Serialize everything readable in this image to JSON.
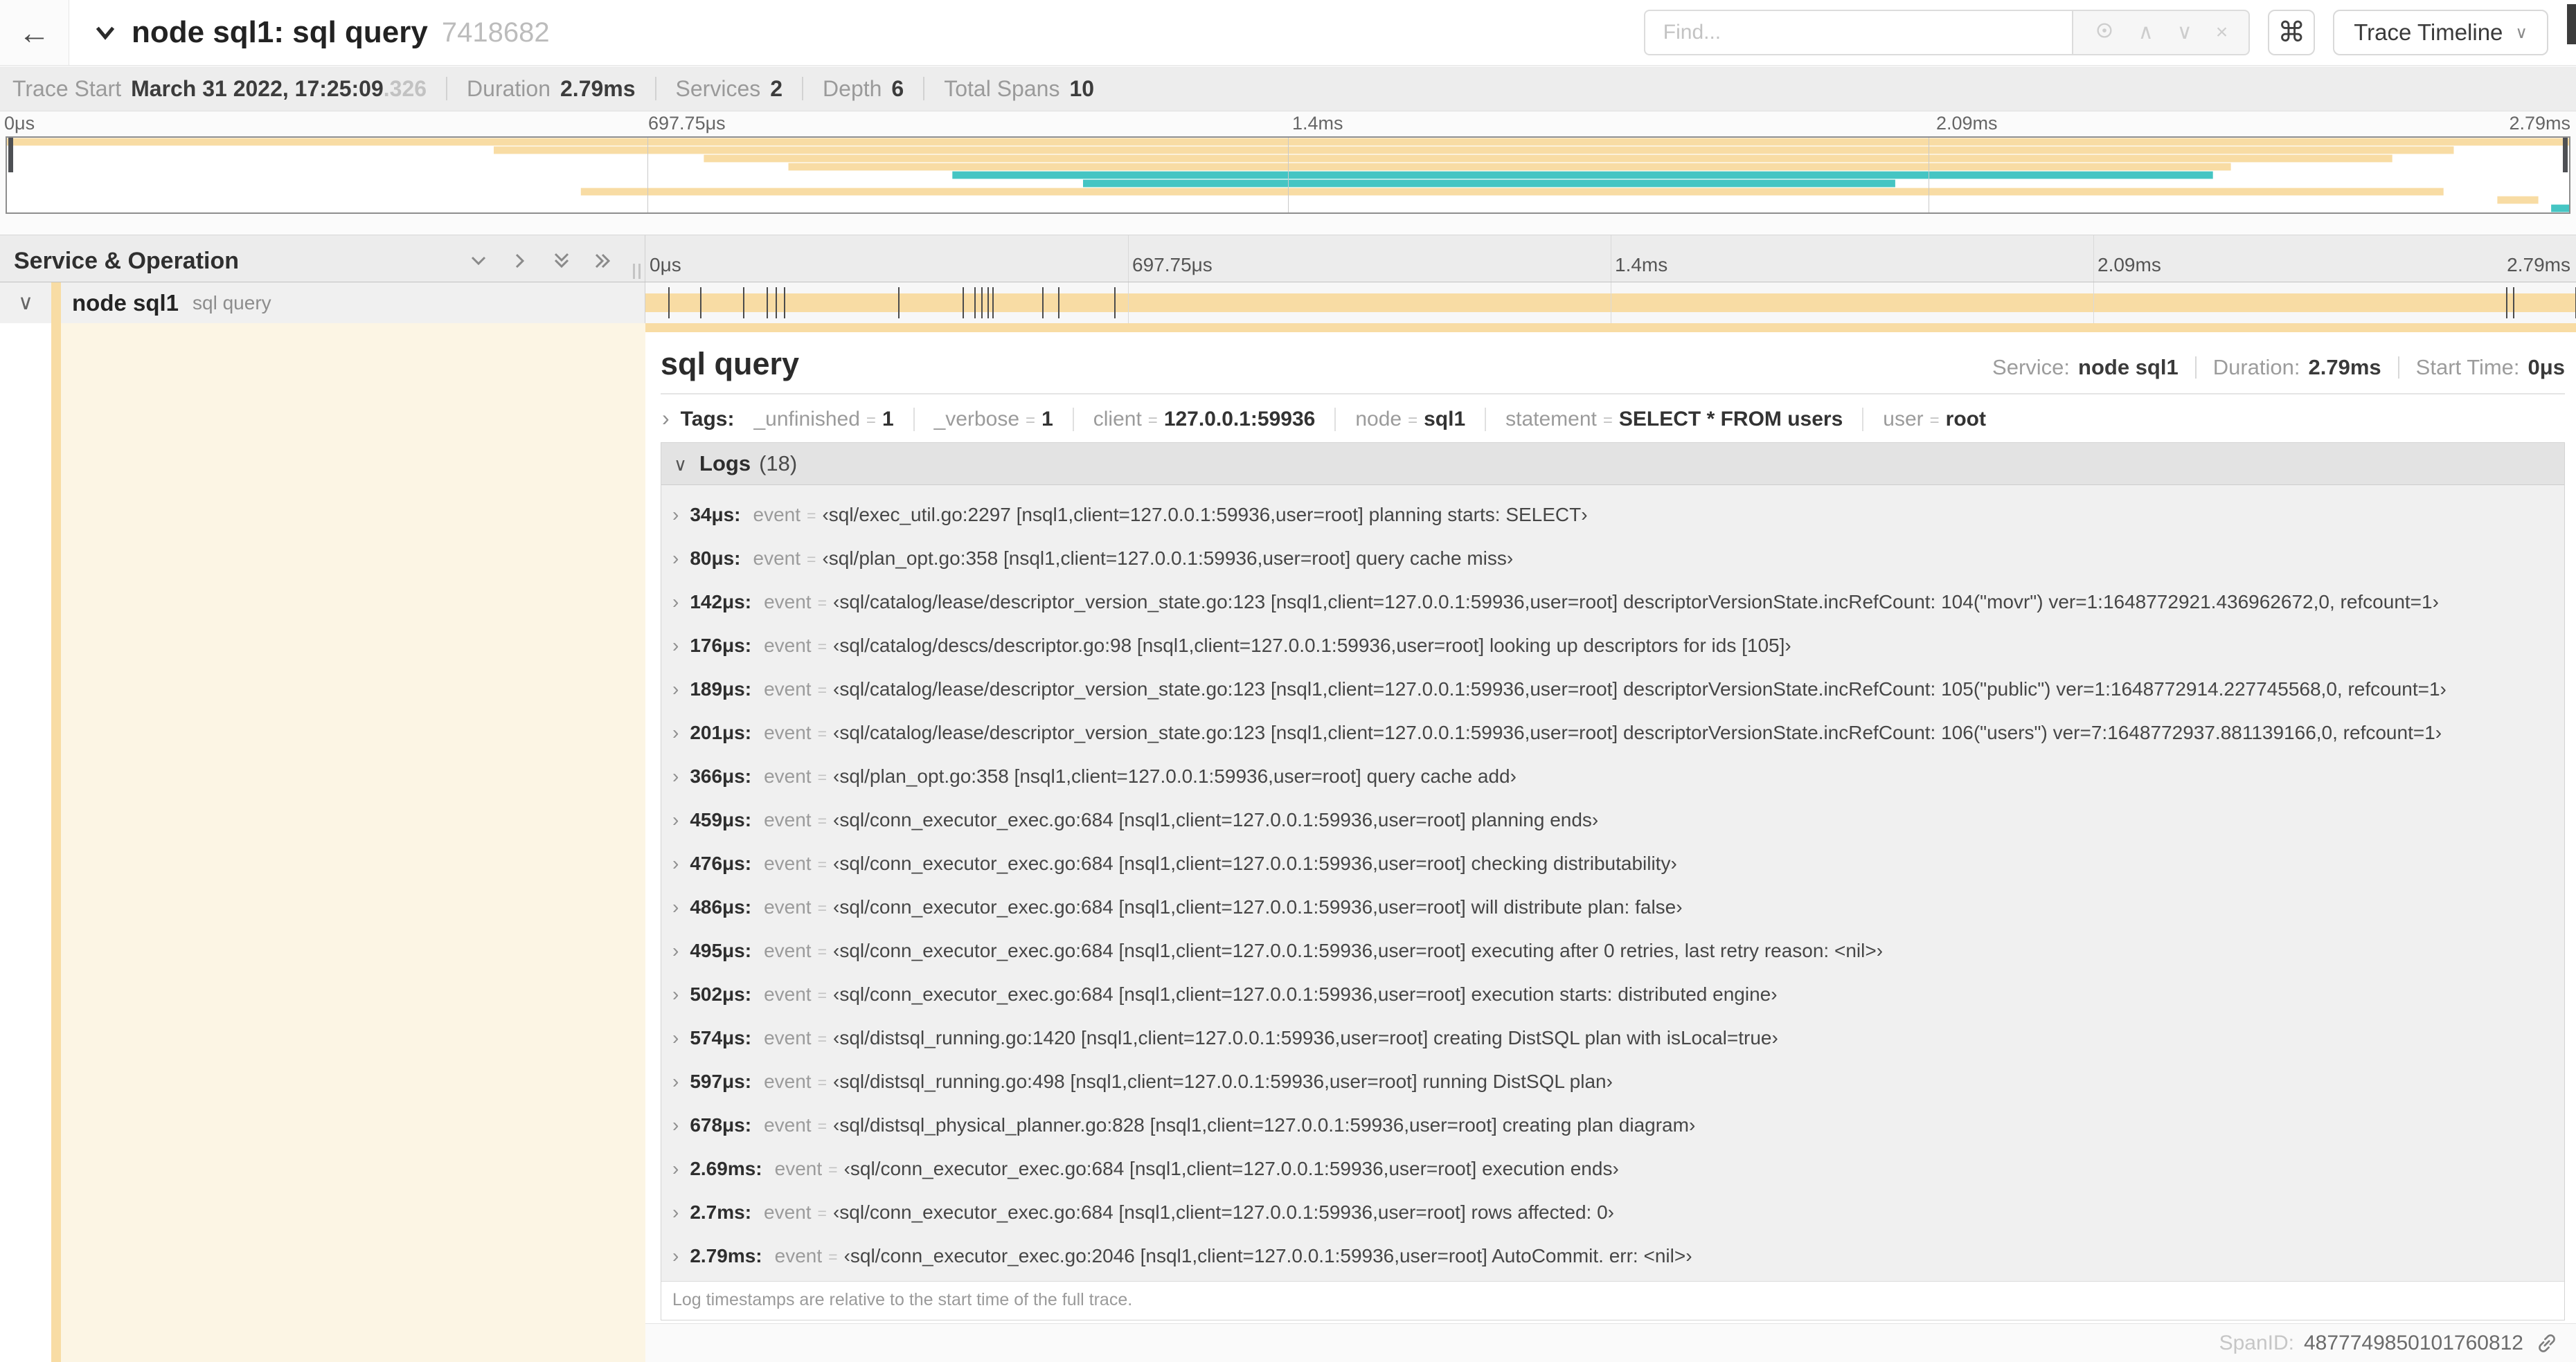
{
  "topbar": {
    "back_label": "←",
    "title": "node sql1: sql query",
    "trace_id": "7418682",
    "find_placeholder": "Find...",
    "find_up": "∧",
    "find_down": "∨",
    "find_close": "×",
    "cmd_label": "⌘",
    "view_label": "Trace Timeline",
    "view_caret": "∨"
  },
  "trace_info": {
    "items": [
      {
        "label": "Trace Start",
        "value": "March 31 2022, 17:25:09",
        "suffix": ".326"
      },
      {
        "label": "Duration",
        "value": "2.79ms"
      },
      {
        "label": "Services",
        "value": "2"
      },
      {
        "label": "Depth",
        "value": "6"
      },
      {
        "label": "Total Spans",
        "value": "10"
      }
    ]
  },
  "timeline": {
    "tick_labels": [
      "0μs",
      "697.75μs",
      "1.4ms",
      "2.09ms",
      "2.79ms"
    ],
    "duration_us": 2790,
    "minimap_spans": [
      {
        "start": 0,
        "end": 1,
        "color": "tan"
      },
      {
        "start": 0.19,
        "end": 0.955,
        "color": "tan"
      },
      {
        "start": 0.272,
        "end": 0.931,
        "color": "tan"
      },
      {
        "start": 0.305,
        "end": 0.868,
        "color": "tan"
      },
      {
        "start": 0.369,
        "end": 0.861,
        "color": "teal"
      },
      {
        "start": 0.42,
        "end": 0.737,
        "color": "teal"
      },
      {
        "start": 0.224,
        "end": 0.951,
        "color": "tan"
      },
      {
        "start": 0.972,
        "end": 0.988,
        "color": "tan"
      },
      {
        "start": 0.993,
        "end": 1.0,
        "color": "teal"
      }
    ]
  },
  "grid": {
    "header_label": "Service & Operation"
  },
  "span": {
    "service": "node sql1",
    "operation": "sql query",
    "chevron": "∨"
  },
  "detail": {
    "title": "sql query",
    "meta": [
      {
        "label": "Service:",
        "value": "node sql1"
      },
      {
        "label": "Duration:",
        "value": "2.79ms"
      },
      {
        "label": "Start Time:",
        "value": "0μs"
      }
    ],
    "tags_label": "Tags:",
    "tags": [
      {
        "key": "_unfinished",
        "value": "1"
      },
      {
        "key": "_verbose",
        "value": "1"
      },
      {
        "key": "client",
        "value": "127.0.0.1:59936"
      },
      {
        "key": "node",
        "value": "sql1"
      },
      {
        "key": "statement",
        "value": "SELECT * FROM users"
      },
      {
        "key": "user",
        "value": "root"
      }
    ],
    "logs_label": "Logs",
    "logs_count": "(18)",
    "logs": [
      {
        "time": "34μs:",
        "t_us": 34,
        "key": "event",
        "value": "‹sql/exec_util.go:2297 [nsql1,client=127.0.0.1:59936,user=root] planning starts: SELECT›"
      },
      {
        "time": "80μs:",
        "t_us": 80,
        "key": "event",
        "value": "‹sql/plan_opt.go:358 [nsql1,client=127.0.0.1:59936,user=root] query cache miss›"
      },
      {
        "time": "142μs:",
        "t_us": 142,
        "key": "event",
        "value": "‹sql/catalog/lease/descriptor_version_state.go:123 [nsql1,client=127.0.0.1:59936,user=root] descriptorVersionState.incRefCount: 104(\"movr\") ver=1:1648772921.436962672,0, refcount=1›"
      },
      {
        "time": "176μs:",
        "t_us": 176,
        "key": "event",
        "value": "‹sql/catalog/descs/descriptor.go:98 [nsql1,client=127.0.0.1:59936,user=root] looking up descriptors for ids [105]›"
      },
      {
        "time": "189μs:",
        "t_us": 189,
        "key": "event",
        "value": "‹sql/catalog/lease/descriptor_version_state.go:123 [nsql1,client=127.0.0.1:59936,user=root] descriptorVersionState.incRefCount: 105(\"public\") ver=1:1648772914.227745568,0, refcount=1›"
      },
      {
        "time": "201μs:",
        "t_us": 201,
        "key": "event",
        "value": "‹sql/catalog/lease/descriptor_version_state.go:123 [nsql1,client=127.0.0.1:59936,user=root] descriptorVersionState.incRefCount: 106(\"users\") ver=7:1648772937.881139166,0, refcount=1›"
      },
      {
        "time": "366μs:",
        "t_us": 366,
        "key": "event",
        "value": "‹sql/plan_opt.go:358 [nsql1,client=127.0.0.1:59936,user=root] query cache add›"
      },
      {
        "time": "459μs:",
        "t_us": 459,
        "key": "event",
        "value": "‹sql/conn_executor_exec.go:684 [nsql1,client=127.0.0.1:59936,user=root] planning ends›"
      },
      {
        "time": "476μs:",
        "t_us": 476,
        "key": "event",
        "value": "‹sql/conn_executor_exec.go:684 [nsql1,client=127.0.0.1:59936,user=root] checking distributability›"
      },
      {
        "time": "486μs:",
        "t_us": 486,
        "key": "event",
        "value": "‹sql/conn_executor_exec.go:684 [nsql1,client=127.0.0.1:59936,user=root] will distribute plan: false›"
      },
      {
        "time": "495μs:",
        "t_us": 495,
        "key": "event",
        "value": "‹sql/conn_executor_exec.go:684 [nsql1,client=127.0.0.1:59936,user=root] executing after 0 retries, last retry reason: <nil>›"
      },
      {
        "time": "502μs:",
        "t_us": 502,
        "key": "event",
        "value": "‹sql/conn_executor_exec.go:684 [nsql1,client=127.0.0.1:59936,user=root] execution starts: distributed engine›"
      },
      {
        "time": "574μs:",
        "t_us": 574,
        "key": "event",
        "value": "‹sql/distsql_running.go:1420 [nsql1,client=127.0.0.1:59936,user=root] creating DistSQL plan with isLocal=true›"
      },
      {
        "time": "597μs:",
        "t_us": 597,
        "key": "event",
        "value": "‹sql/distsql_running.go:498 [nsql1,client=127.0.0.1:59936,user=root] running DistSQL plan›"
      },
      {
        "time": "678μs:",
        "t_us": 678,
        "key": "event",
        "value": "‹sql/distsql_physical_planner.go:828 [nsql1,client=127.0.0.1:59936,user=root] creating plan diagram›"
      },
      {
        "time": "2.69ms:",
        "t_us": 2690,
        "key": "event",
        "value": "‹sql/conn_executor_exec.go:684 [nsql1,client=127.0.0.1:59936,user=root] execution ends›"
      },
      {
        "time": "2.7ms:",
        "t_us": 2700,
        "key": "event",
        "value": "‹sql/conn_executor_exec.go:684 [nsql1,client=127.0.0.1:59936,user=root] rows affected: 0›"
      },
      {
        "time": "2.79ms:",
        "t_us": 2790,
        "key": "event",
        "value": "‹sql/conn_executor_exec.go:2046 [nsql1,client=127.0.0.1:59936,user=root] AutoCommit. err: <nil>›"
      }
    ],
    "note": "Log timestamps are relative to the start time of the full trace.",
    "span_id_label": "SpanID:",
    "span_id": "4877749850101760812"
  },
  "colors": {
    "tan": "#F8DCA4",
    "teal": "#45C5C3",
    "cream": "#FCF5E4"
  }
}
